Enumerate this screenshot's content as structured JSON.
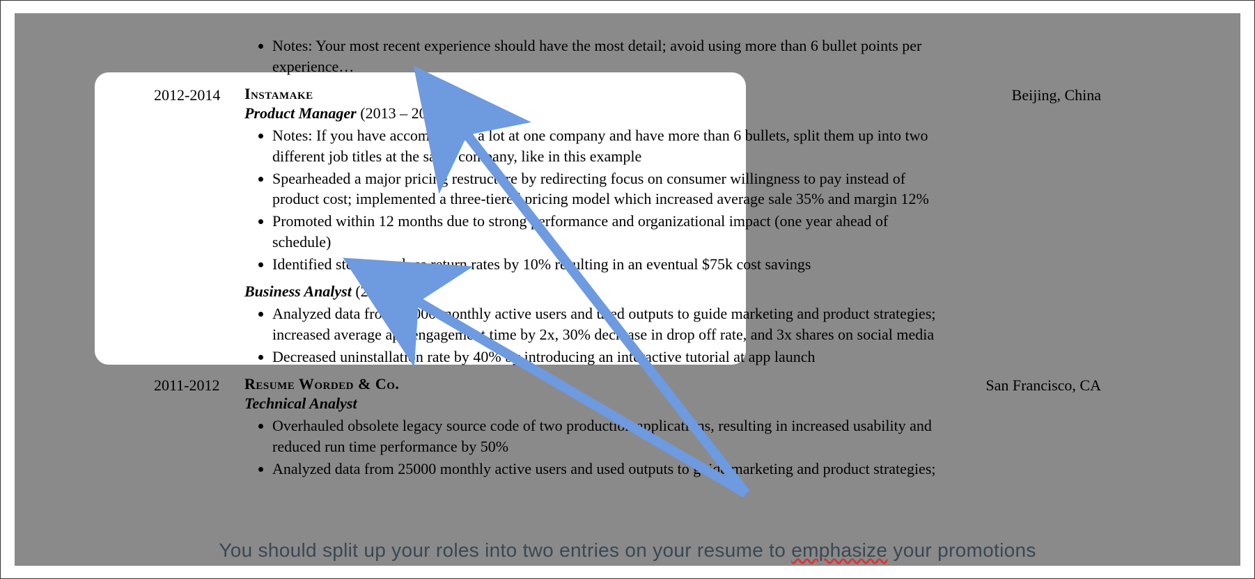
{
  "note_top": "Notes: Your most recent experience should have the most detail; avoid using more than 6 bullet points per experience…",
  "job1": {
    "dates": "2012-2014",
    "company": "Instamake",
    "location": "Beijing, China",
    "role1_title": "Product Manager",
    "role1_years": " (2013 – 2014)",
    "role1_bullets": [
      "Notes: If you have accomplished a lot at one company and have more than 6 bullets, split them up into two different job titles at the same company, like in this example",
      "Spearheaded a major pricing restructure by redirecting focus on consumer willingness to pay instead of product cost; implemented a three-tiered pricing model which increased average sale 35% and margin 12%",
      "Promoted within 12 months due to strong performance and organizational impact (one year ahead of schedule)",
      "Identified steps to reduce return rates by 10% resulting in an eventual $75k cost savings"
    ],
    "role2_title": "Business Analyst",
    "role2_years": " (2012)",
    "role2_bullets": [
      "Analyzed data from 25000 monthly active users and used outputs to guide marketing and product strategies; increased average app engagement time by 2x, 30% decrease in drop off rate, and 3x shares on social media",
      "Decreased uninstallation rate by 40% by introducing an interactive tutorial at app launch"
    ]
  },
  "job2": {
    "dates": "2011-2012",
    "company": "Resume Worded & Co.",
    "location": "San Francisco, CA",
    "role_title": "Technical Analyst",
    "bullets": [
      "Overhauled obsolete legacy source code of two production applications, resulting in increased usability and reduced run time performance by 50%",
      "Analyzed data from 25000 monthly active users and used outputs to guide marketing and product strategies;"
    ]
  },
  "caption_pre": "You should split up your roles into two entries on your resume to ",
  "caption_em": "emphasize",
  "caption_post": " your promotions"
}
